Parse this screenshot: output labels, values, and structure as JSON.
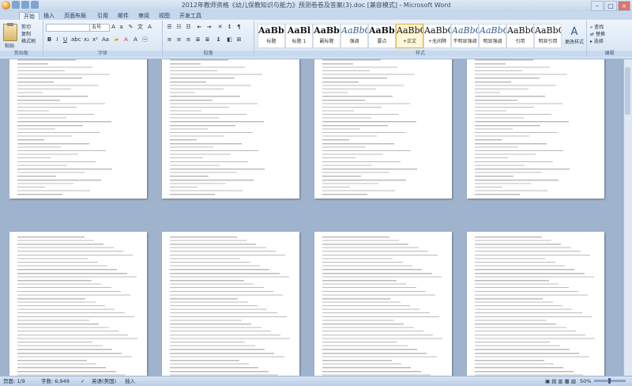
{
  "window": {
    "title": "2012年教师资格《幼儿保教知识与能力》预测卷卷及答案(3).doc [兼容模式] - Microsoft Word"
  },
  "tabs": [
    "开始",
    "插入",
    "页面布局",
    "引用",
    "邮件",
    "审阅",
    "视图",
    "开发工具"
  ],
  "clipboard": {
    "paste": "粘贴",
    "cut": "剪切",
    "copy": "复制",
    "format_painter": "格式刷",
    "label": "剪贴板"
  },
  "font": {
    "name": "",
    "size": "五号",
    "label": "字体"
  },
  "paragraph": {
    "label": "段落"
  },
  "styles": {
    "label": "样式",
    "items": [
      {
        "sample": "AaBbC",
        "name": "标题"
      },
      {
        "sample": "AaBl",
        "name": "标题 1"
      },
      {
        "sample": "AaBb",
        "name": "副标题"
      },
      {
        "sample": "AaBbCcDd",
        "name": "强调"
      },
      {
        "sample": "AaBbCcD",
        "name": "要点"
      },
      {
        "sample": "AaBbCcDd",
        "name": "+正文"
      },
      {
        "sample": "AaBbCcDd",
        "name": "+无间隔"
      },
      {
        "sample": "AaBbCcD",
        "name": "不明显强调"
      },
      {
        "sample": "AaBbCcD",
        "name": "明显强调"
      },
      {
        "sample": "AaBbCcD",
        "name": "引用"
      },
      {
        "sample": "AaBbCcD",
        "name": "明显引用"
      }
    ],
    "change_styles": "更改样式"
  },
  "editing": {
    "find": "查找",
    "replace": "替换",
    "select": "选择",
    "label": "编辑"
  },
  "status": {
    "page": "页面: 1/9",
    "words": "字数: 6,949",
    "lang": "英语(美国)",
    "mode": "插入",
    "zoom": "50%"
  }
}
